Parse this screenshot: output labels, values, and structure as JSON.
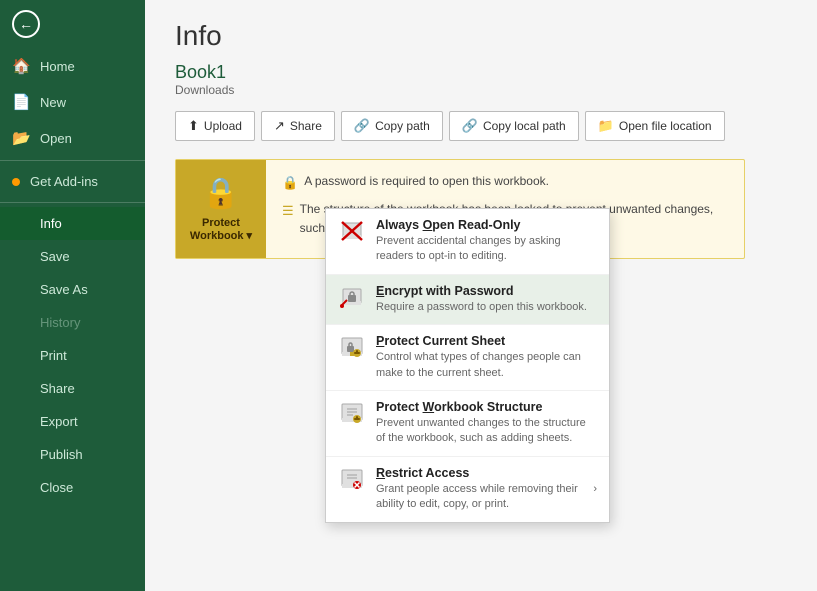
{
  "sidebar": {
    "back_icon": "←",
    "items": [
      {
        "id": "home",
        "icon": "🏠",
        "label": "Home",
        "active": false
      },
      {
        "id": "new",
        "icon": "📄",
        "label": "New",
        "active": false
      },
      {
        "id": "open",
        "icon": "📂",
        "label": "Open",
        "active": false
      }
    ],
    "dot_items": [
      {
        "id": "get-add-ins",
        "label": "Get Add-ins",
        "dot": true
      }
    ],
    "bottom_items": [
      {
        "id": "info",
        "label": "Info",
        "active": true
      },
      {
        "id": "save",
        "label": "Save",
        "active": false
      },
      {
        "id": "save-as",
        "label": "Save As",
        "active": false
      },
      {
        "id": "history",
        "label": "History",
        "active": false,
        "disabled": true
      },
      {
        "id": "print",
        "label": "Print",
        "active": false
      },
      {
        "id": "share",
        "label": "Share",
        "active": false
      },
      {
        "id": "export",
        "label": "Export",
        "active": false
      },
      {
        "id": "publish",
        "label": "Publish",
        "active": false
      },
      {
        "id": "close",
        "label": "Close",
        "active": false
      }
    ]
  },
  "main": {
    "page_title": "Info",
    "file_name": "Book1",
    "file_location": "Downloads",
    "toolbar": {
      "upload_label": "Upload",
      "share_label": "Share",
      "copy_path_label": "Copy path",
      "copy_local_path_label": "Copy local path",
      "open_file_location_label": "Open file location"
    },
    "protect": {
      "title": "Protect Workbook",
      "button_label": "Protect\nWorkbook",
      "dropdown_arrow": "▾",
      "detail1": "A password is required to open this workbook.",
      "detail2": "The structure of the workbook has been locked to prevent unwanted changes, such as moving, deleting, or adding sheets."
    },
    "dropdown": {
      "items": [
        {
          "id": "always-open-read-only",
          "title": "Always Open Read-Only",
          "underline_char": "O",
          "desc": "Prevent accidental changes by asking readers to opt-in to editing.",
          "icon": "🚫",
          "highlighted": false,
          "has_arrow": false
        },
        {
          "id": "encrypt-with-password",
          "title": "Encrypt with Password",
          "underline_char": "E",
          "desc": "Require a password to open this workbook.",
          "icon": "🔒",
          "highlighted": true,
          "has_arrow": false
        },
        {
          "id": "protect-current-sheet",
          "title": "Protect Current Sheet",
          "underline_char": "P",
          "desc": "Control what types of changes people can make to the current sheet.",
          "icon": "🛡",
          "highlighted": false,
          "has_arrow": false
        },
        {
          "id": "protect-workbook-structure",
          "title": "Protect Workbook Structure",
          "underline_char": "W",
          "desc": "Prevent unwanted changes to the structure of the workbook, such as adding sheets.",
          "icon": "📋",
          "highlighted": false,
          "has_arrow": false
        },
        {
          "id": "restrict-access",
          "title": "Restrict Access",
          "underline_char": "R",
          "desc": "Grant people access while removing their ability to edit, copy, or print.",
          "icon": "🔑",
          "highlighted": false,
          "has_arrow": true
        }
      ]
    }
  }
}
